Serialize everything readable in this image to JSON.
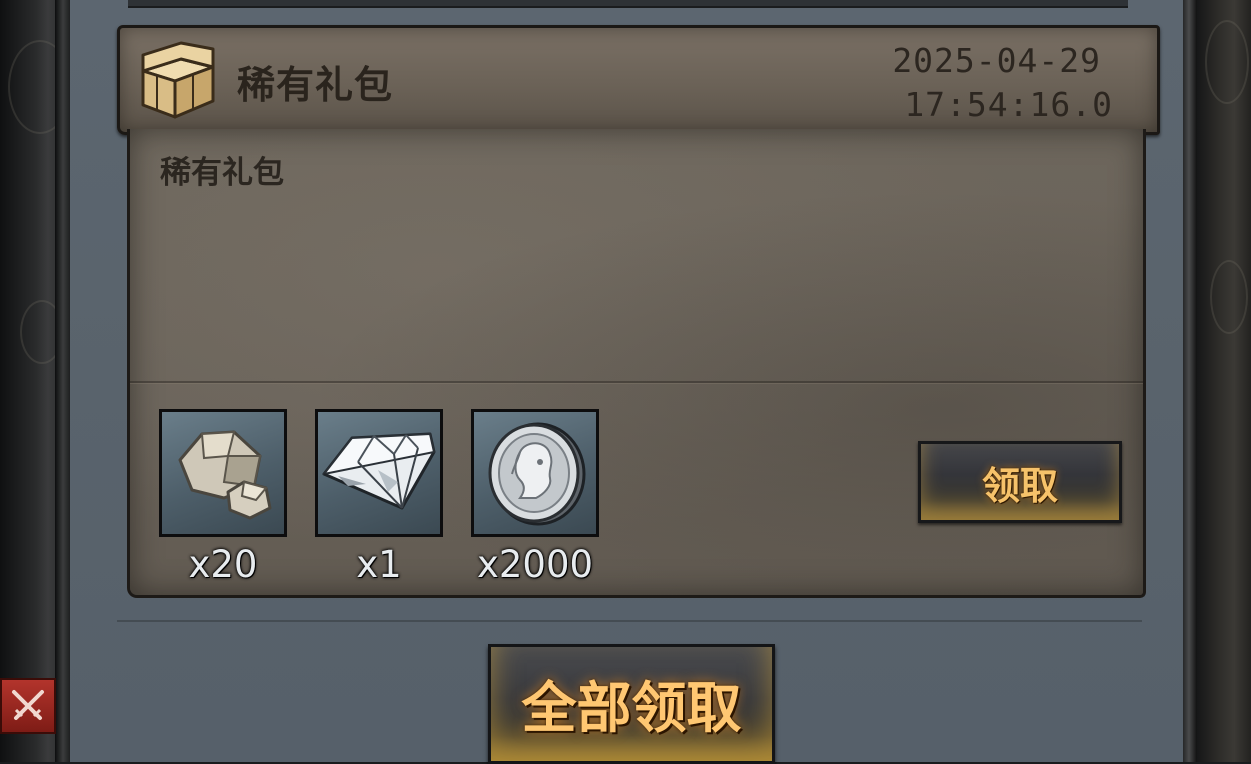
{
  "mail": {
    "title": "稀有礼包",
    "date": "2025-04-29",
    "time": "17:54:16.0",
    "body": "稀有礼包",
    "icon": "treasure-chest-icon"
  },
  "rewards": [
    {
      "icon": "stone-ore-icon",
      "quantity": "x20"
    },
    {
      "icon": "diamond-icon",
      "quantity": "x1"
    },
    {
      "icon": "silver-coin-icon",
      "quantity": "x2000"
    }
  ],
  "buttons": {
    "claim_label": "领取",
    "claim_all_label": "全部领取"
  },
  "side": {
    "icon": "crossed-swords-icon"
  },
  "colors": {
    "button_text": "#f6c26a",
    "panel": "#5c6670",
    "parchment": "#6d665c"
  }
}
